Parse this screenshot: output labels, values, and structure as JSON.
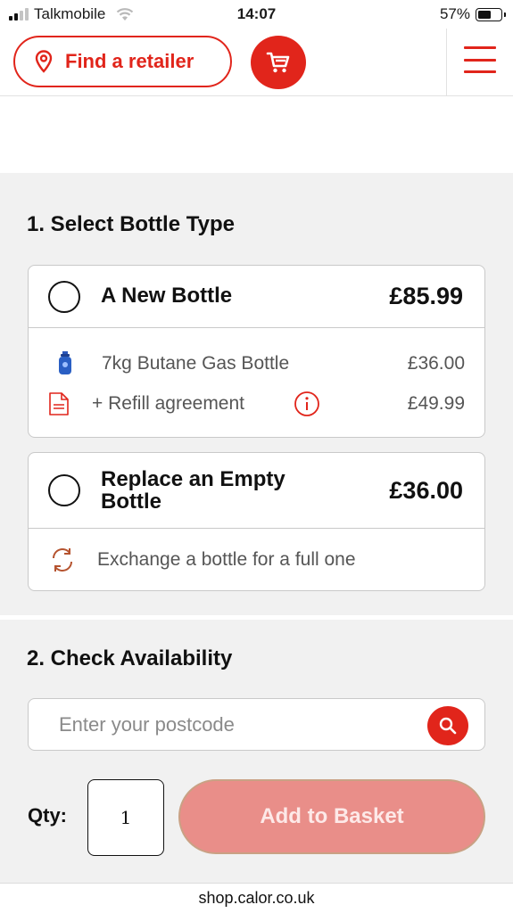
{
  "status_bar": {
    "carrier": "Talkmobile",
    "time": "14:07",
    "battery": "57%",
    "battery_level": 0.57
  },
  "header": {
    "find_retailer_label": "Find a retailer"
  },
  "section1": {
    "title": "1. Select Bottle Type",
    "options": [
      {
        "label": "A New Bottle",
        "price": "£85.99",
        "rows": [
          {
            "text": "7kg Butane Gas Bottle",
            "amount": "£36.00"
          },
          {
            "text": "+ Refill agreement",
            "amount": "£49.99"
          }
        ]
      },
      {
        "label_line1": "Replace an Empty",
        "label_line2": "Bottle",
        "price": "£36.00",
        "rows": [
          {
            "text": "Exchange a bottle for a full one"
          }
        ]
      }
    ]
  },
  "section2": {
    "title": "2. Check Availability",
    "postcode_placeholder": "Enter your postcode",
    "qty_label": "Qty:",
    "qty_value": "1",
    "add_button": "Add to Basket"
  },
  "url": "shop.calor.co.uk",
  "colors": {
    "brand_red": "#e1251b",
    "add_button_disabled": "#e98e89",
    "page_bg": "#f1f1f1"
  }
}
